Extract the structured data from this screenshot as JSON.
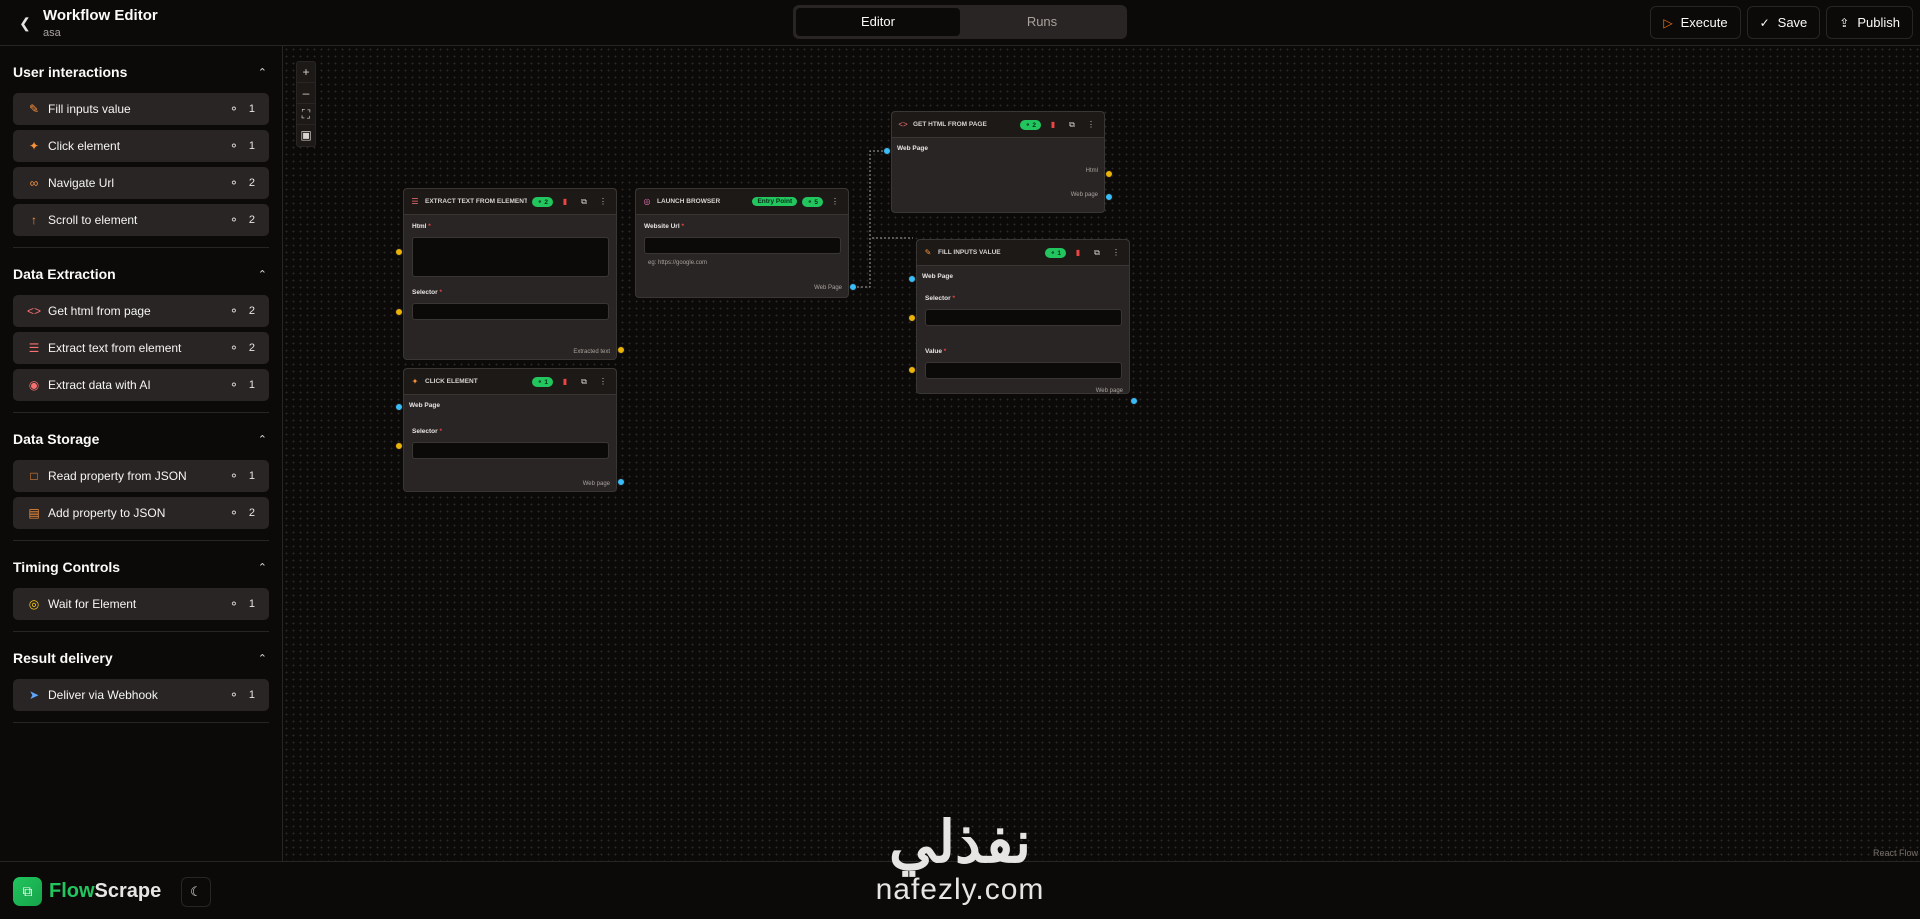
{
  "header": {
    "title": "Workflow Editor",
    "subtitle": "asa",
    "tabs": [
      {
        "label": "Editor"
      },
      {
        "label": "Runs"
      }
    ],
    "actions": {
      "execute": "Execute",
      "save": "Save",
      "publish": "Publish"
    }
  },
  "sidebar": {
    "sections": [
      {
        "title": "User interactions",
        "items": [
          {
            "label": "Fill inputs value",
            "credits": "1"
          },
          {
            "label": "Click element",
            "credits": "1"
          },
          {
            "label": "Navigate Url",
            "credits": "2"
          },
          {
            "label": "Scroll to element",
            "credits": "2"
          }
        ]
      },
      {
        "title": "Data Extraction",
        "items": [
          {
            "label": "Get html from page",
            "credits": "2"
          },
          {
            "label": "Extract text from element",
            "credits": "2"
          },
          {
            "label": "Extract data with AI",
            "credits": "1"
          }
        ]
      },
      {
        "title": "Data Storage",
        "items": [
          {
            "label": "Read property from JSON",
            "credits": "1"
          },
          {
            "label": "Add property to JSON",
            "credits": "2"
          }
        ]
      },
      {
        "title": "Timing Controls",
        "items": [
          {
            "label": "Wait for Element",
            "credits": "1"
          }
        ]
      },
      {
        "title": "Result delivery",
        "items": [
          {
            "label": "Deliver via Webhook",
            "credits": "1"
          }
        ]
      }
    ]
  },
  "footer": {
    "logo_a": "Flow",
    "logo_b": "Scrape"
  },
  "canvas": {
    "attribution": "React Flow",
    "nodes": {
      "extract": {
        "title": "EXTRACT TEXT FROM ELEMENT",
        "credits": "2",
        "f1": "Html",
        "f2": "Selector",
        "out": "Extracted text"
      },
      "launch": {
        "title": "LAUNCH BROWSER",
        "entry": "Entry Point",
        "credits": "5",
        "f1": "Website Url",
        "hint": "eg: https://google.com",
        "out": "Web Page"
      },
      "gethtml": {
        "title": "GET HTML FROM PAGE",
        "credits": "2",
        "in": "Web Page",
        "out1": "Html",
        "out2": "Web page"
      },
      "fill": {
        "title": "FILL INPUTS VALUE",
        "credits": "1",
        "in": "Web Page",
        "f1": "Selector",
        "f2": "Value",
        "out": "Web page"
      },
      "click": {
        "title": "CLICK ELEMENT",
        "credits": "1",
        "in": "Web Page",
        "f1": "Selector",
        "out": "Web page"
      }
    }
  },
  "watermark": {
    "arabic": "نفذلي",
    "latin": "nafezly.com"
  }
}
